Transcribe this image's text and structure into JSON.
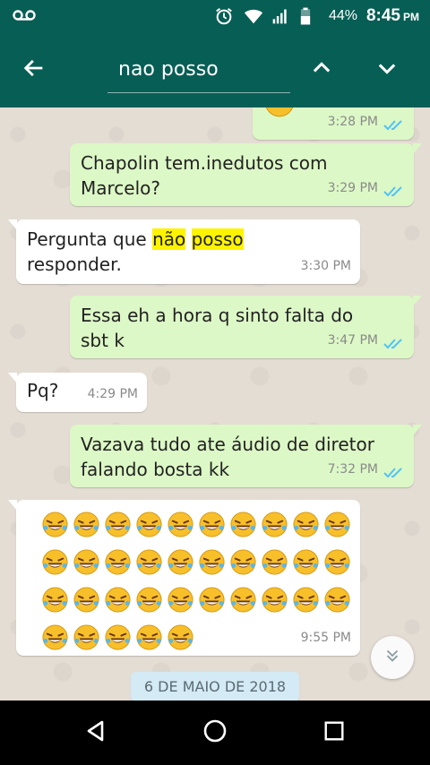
{
  "status_bar": {
    "battery_percent": "44%",
    "time": "8:45",
    "ampm": "PM",
    "icons": [
      "voicemail-icon",
      "alarm-icon",
      "wifi-icon",
      "signal-icon",
      "battery-icon"
    ]
  },
  "search": {
    "query": "nao posso",
    "icons": [
      "back-arrow-icon",
      "chevron-up-icon",
      "chevron-down-icon"
    ]
  },
  "messages": [
    {
      "id": "m0",
      "direction": "out",
      "text": "",
      "time": "3:28 PM",
      "read": true
    },
    {
      "id": "m1",
      "direction": "out",
      "text": "Chapolin tem.inedutos com\nMarcelo?",
      "time": "3:29 PM",
      "read": true
    },
    {
      "id": "m2",
      "direction": "in",
      "text_before": "Pergunta que ",
      "highlight_1": "não",
      "text_mid": " ",
      "highlight_2": "posso",
      "text_after": "\nresponder.",
      "time": "3:30 PM"
    },
    {
      "id": "m3",
      "direction": "out",
      "text": "Essa eh a hora q sinto falta do\nsbt k",
      "time": "3:47 PM",
      "read": true
    },
    {
      "id": "m4",
      "direction": "in",
      "text": "Pq?",
      "time": "4:29 PM"
    },
    {
      "id": "m5",
      "direction": "out",
      "text": "Vazava tudo ate áudio de diretor\nfalando bosta kk",
      "time": "7:32 PM",
      "read": true
    },
    {
      "id": "m6",
      "direction": "in",
      "emoji": "rolling-on-floor-laughing",
      "emoji_count": 35,
      "time": "9:55 PM"
    }
  ],
  "date_chip": "6 DE MAIO DE 2018",
  "colors": {
    "header": "#075e55",
    "outgoing_bubble": "#dcf8c6",
    "incoming_bubble": "#ffffff",
    "highlight": "#fff300",
    "read_ticks": "#4fc3f7",
    "chat_bg": "#e4ddd4"
  },
  "nav_bar": {
    "icons": [
      "back-triangle-icon",
      "home-circle-icon",
      "recents-square-icon"
    ]
  }
}
